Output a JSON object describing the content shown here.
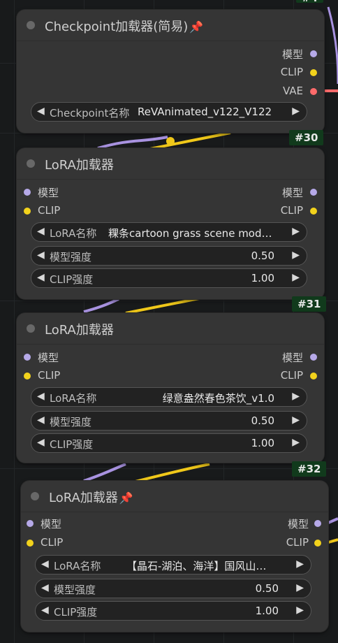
{
  "nodes": {
    "checkpoint": {
      "title": "Checkpoint加载器(简易)",
      "pinned": true,
      "outputs": [
        "模型",
        "CLIP",
        "VAE"
      ],
      "widget": {
        "label": "Checkpoint名称",
        "value": "ReVAnimated_v122_V122"
      },
      "badge": "#30"
    },
    "lora1": {
      "title": "LoRA加载器",
      "inputs": [
        "模型",
        "CLIP"
      ],
      "outputs": [
        "模型",
        "CLIP"
      ],
      "name_label": "LoRA名称",
      "name_value": "粿条cartoon grass scene mod…",
      "model_strength_label": "模型强度",
      "model_strength_value": "0.50",
      "clip_strength_label": "CLIP强度",
      "clip_strength_value": "1.00",
      "badge": "#31"
    },
    "lora2": {
      "title": "LoRA加载器",
      "inputs": [
        "模型",
        "CLIP"
      ],
      "outputs": [
        "模型",
        "CLIP"
      ],
      "name_label": "LoRA名称",
      "name_value": "绿意盎然春色茶饮_v1.0",
      "model_strength_label": "模型强度",
      "model_strength_value": "0.50",
      "clip_strength_label": "CLIP强度",
      "clip_strength_value": "1.00",
      "badge": "#32"
    },
    "lora3": {
      "title": "LoRA加载器",
      "pinned": true,
      "inputs": [
        "模型",
        "CLIP"
      ],
      "outputs": [
        "模型",
        "CLIP"
      ],
      "name_label": "LoRA名称",
      "name_value": "【晶石-湖泊、海洋】国风山…",
      "model_strength_label": "模型强度",
      "model_strength_value": "0.50",
      "clip_strength_label": "CLIP强度",
      "clip_strength_value": "1.00"
    }
  },
  "icons": {
    "pin": "pushpin-icon",
    "left": "arrow-left-icon",
    "right": "arrow-right-icon"
  },
  "colors": {
    "model": "#b6a9e8",
    "clip": "#f2d21c",
    "vae": "#ff6b6b",
    "link_model": "#a892e0",
    "link_clip": "#f0c81a"
  }
}
